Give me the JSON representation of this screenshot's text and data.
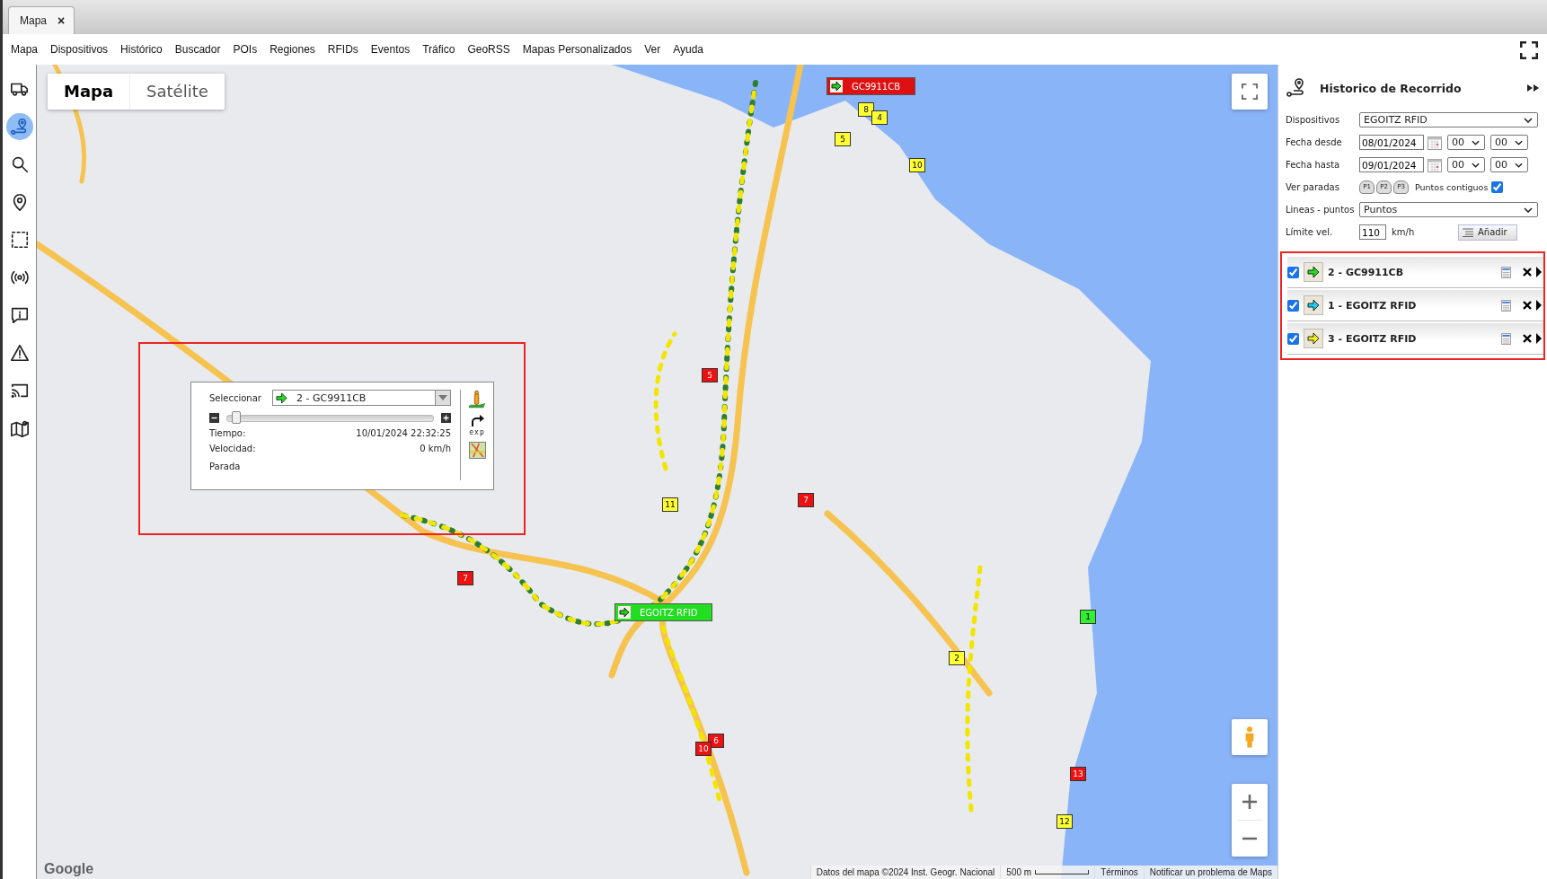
{
  "tabs": [
    {
      "label": "Mapa",
      "close": "×",
      "selected": true
    }
  ],
  "menu": [
    "Mapa",
    "Dispositivos",
    "Histórico",
    "Buscador",
    "POIs",
    "Regiones",
    "RFIDs",
    "Eventos",
    "Tráfico",
    "GeoRSS",
    "Mapas Personalizados",
    "Ver",
    "Ayuda"
  ],
  "sidebar_tools": [
    {
      "kind": "truck",
      "selected": false
    },
    {
      "kind": "route",
      "selected": true
    },
    {
      "kind": "search",
      "selected": false
    },
    {
      "kind": "pin",
      "selected": false
    },
    {
      "kind": "region",
      "selected": false
    },
    {
      "kind": "signal",
      "selected": false
    },
    {
      "kind": "info",
      "selected": false
    },
    {
      "kind": "warning",
      "selected": false
    },
    {
      "kind": "cast",
      "selected": false
    },
    {
      "kind": "map",
      "selected": false
    }
  ],
  "map": {
    "map_types": [
      {
        "label": "Mapa",
        "selected": true
      },
      {
        "label": "Satélite",
        "selected": false
      }
    ],
    "vehicle_labels": [
      {
        "label": "GC9911CB",
        "color": "#dd1111"
      },
      {
        "label": "EGOITZ RFID",
        "color": "#22dd22"
      }
    ],
    "stop_markers": [
      {
        "label": "8",
        "color": "#ffff33"
      },
      {
        "label": "4",
        "color": "#ffff33"
      },
      {
        "label": "5",
        "color": "#ffff33"
      },
      {
        "label": "10",
        "color": "#ffff33"
      },
      {
        "label": "5",
        "color": "#ee1111"
      },
      {
        "label": "7",
        "color": "#ee1111"
      },
      {
        "label": "11",
        "color": "#ffff33"
      },
      {
        "label": "7",
        "color": "#ee1111"
      },
      {
        "label": "1",
        "color": "#33ee33"
      },
      {
        "label": "2",
        "color": "#ffff33"
      },
      {
        "label": "6",
        "color": "#ee1111"
      },
      {
        "label": "10",
        "color": "#ee1111"
      },
      {
        "label": "13",
        "color": "#ee1111"
      },
      {
        "label": "12",
        "color": "#ffff33"
      }
    ],
    "playback": {
      "select_label": "Seleccionar",
      "selected_track": "2 - GC9911CB",
      "level": 0.02,
      "fields": [
        {
          "label": "Tiempo:",
          "value": "10/01/2024 22:32:25"
        },
        {
          "label": "Velocidad:",
          "value": "0 km/h"
        }
      ],
      "status": "Parada",
      "export_label": "exp"
    },
    "logo": "Google",
    "attribution": "Datos del mapa ©2024 Inst. Geogr. Nacional",
    "scale": "500 m",
    "terms": "Términos",
    "report": "Notificar un problema de Maps"
  },
  "panel": {
    "title": "Historico de Recorrido",
    "dispositivos": {
      "label": "Dispositivos",
      "value": "EGOITZ RFID"
    },
    "fecha_desde": {
      "label": "Fecha desde",
      "date": "08/01/2024",
      "hour": "00",
      "minute": "00"
    },
    "fecha_hasta": {
      "label": "Fecha hasta",
      "date": "09/01/2024",
      "hour": "00",
      "minute": "00"
    },
    "ver_paradas": {
      "label": "Ver paradas",
      "stops": [
        "P1",
        "P2",
        "P3"
      ]
    },
    "puntos_contiguos": {
      "label": "Puntos contiguos",
      "checked": true
    },
    "lineas_puntos": {
      "label": "Lineas - puntos",
      "value": "Puntos"
    },
    "limite": {
      "label": "Límite vel.",
      "value": "110",
      "unit": "km/h"
    },
    "add_button": "Añadir",
    "tracks": [
      {
        "label": "2 - GC9911CB",
        "color": "#22dd22",
        "checked": true
      },
      {
        "label": "1 - EGOITZ RFID",
        "color": "#22ccee",
        "checked": true
      },
      {
        "label": "3 - EGOITZ RFID",
        "color": "#eeee22",
        "checked": true
      }
    ]
  }
}
